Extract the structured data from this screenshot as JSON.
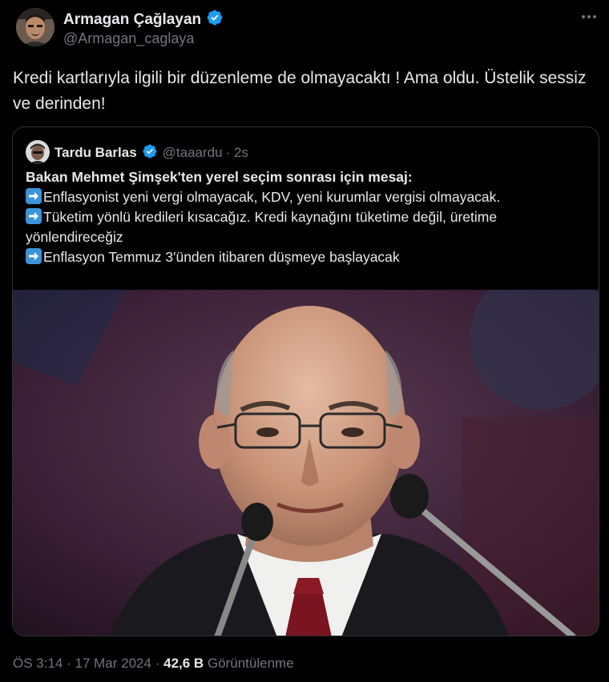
{
  "author": {
    "name": "Armagan Çağlayan",
    "handle": "@Armagan_caglaya",
    "verified": true,
    "avatar_icon": "profile-avatar"
  },
  "tweet": {
    "text": "Kredi kartlarıyla ilgili bir düzenleme de olmayacaktı ! Ama oldu. Üstelik sessiz ve derinden!"
  },
  "quote": {
    "name": "Tardu Barlas",
    "handle": "@taaardu",
    "time": "· 2s",
    "verified": true,
    "lead": "Bakan Mehmet Şimşek'ten yerel seçim sonrası için mesaj:",
    "points": [
      "Enflasyonist yeni vergi olmayacak, KDV, yeni kurumlar vergisi olmayacak.",
      "Tüketim yönlü kredileri kısacağız. Kredi kaynağını tüketime değil, üretime yönlendireceğiz",
      "Enflasyon Temmuz 3'ünden itibaren düşmeye başlayacak"
    ],
    "bullet_icon": "right-arrow-emoji",
    "image_icon": "portrait-photo"
  },
  "footer": {
    "time": "ÖS 3:14",
    "separator": "·",
    "date": "17 Mar 2024",
    "views_count": "42,6 B",
    "views_label": "Görüntülenme"
  },
  "colors": {
    "background": "#000000",
    "text": "#e7e9ea",
    "muted": "#71767b",
    "verified_blue": "#1d9bf0",
    "border": "#2f3336",
    "arrow_emoji": "#3b94d9"
  }
}
